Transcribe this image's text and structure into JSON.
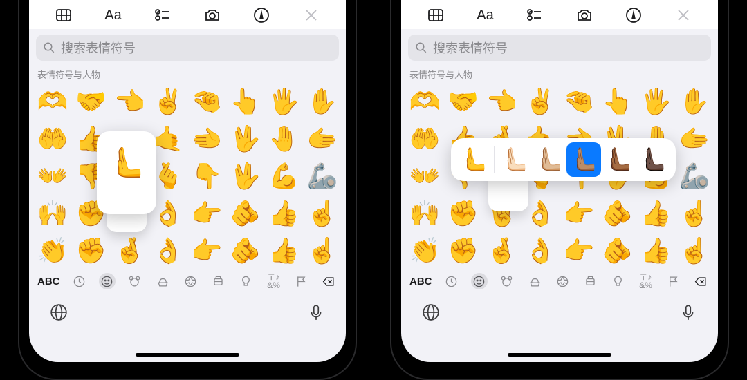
{
  "toolbar": {
    "table_icon": "table-icon",
    "font_label": "Aa",
    "checklist_icon": "checklist-icon",
    "camera_icon": "camera-icon",
    "markup_icon": "markup-icon",
    "close_icon": "close-icon"
  },
  "search": {
    "placeholder": "搜索表情符号"
  },
  "section_label": "表情符号与人物",
  "emoji_rows": [
    [
      "🫶",
      "🤝",
      "👈",
      "✌️",
      "🤏",
      "👆",
      "🖐️",
      "✋"
    ],
    [
      "🤲",
      "👍",
      "🤞",
      "🤙",
      "🫲",
      "🖖",
      "🤚",
      "🫱"
    ],
    [
      "👐",
      "👎",
      "🤟",
      "🫰",
      "👇",
      "🖖",
      "💪",
      "🦾"
    ],
    [
      "🙌",
      "✊",
      "🤘",
      "👌",
      "👉",
      "🫵",
      "👍",
      "☝️"
    ],
    [
      "👏",
      "✊",
      "🤞",
      "👌",
      "👉",
      "🫵",
      "👍",
      "☝️"
    ]
  ],
  "cats": {
    "abc": "ABC",
    "items": [
      "recent",
      "smileys",
      "animals",
      "food",
      "activity",
      "travel",
      "objects",
      "symbols",
      "flags",
      "delete"
    ]
  },
  "preview": {
    "single_emoji": "🫷",
    "skins": [
      "🫷",
      "🫷🏻",
      "🫷🏼",
      "🫷🏽",
      "🫷🏾",
      "🫷🏿"
    ],
    "selected_index": 3
  }
}
